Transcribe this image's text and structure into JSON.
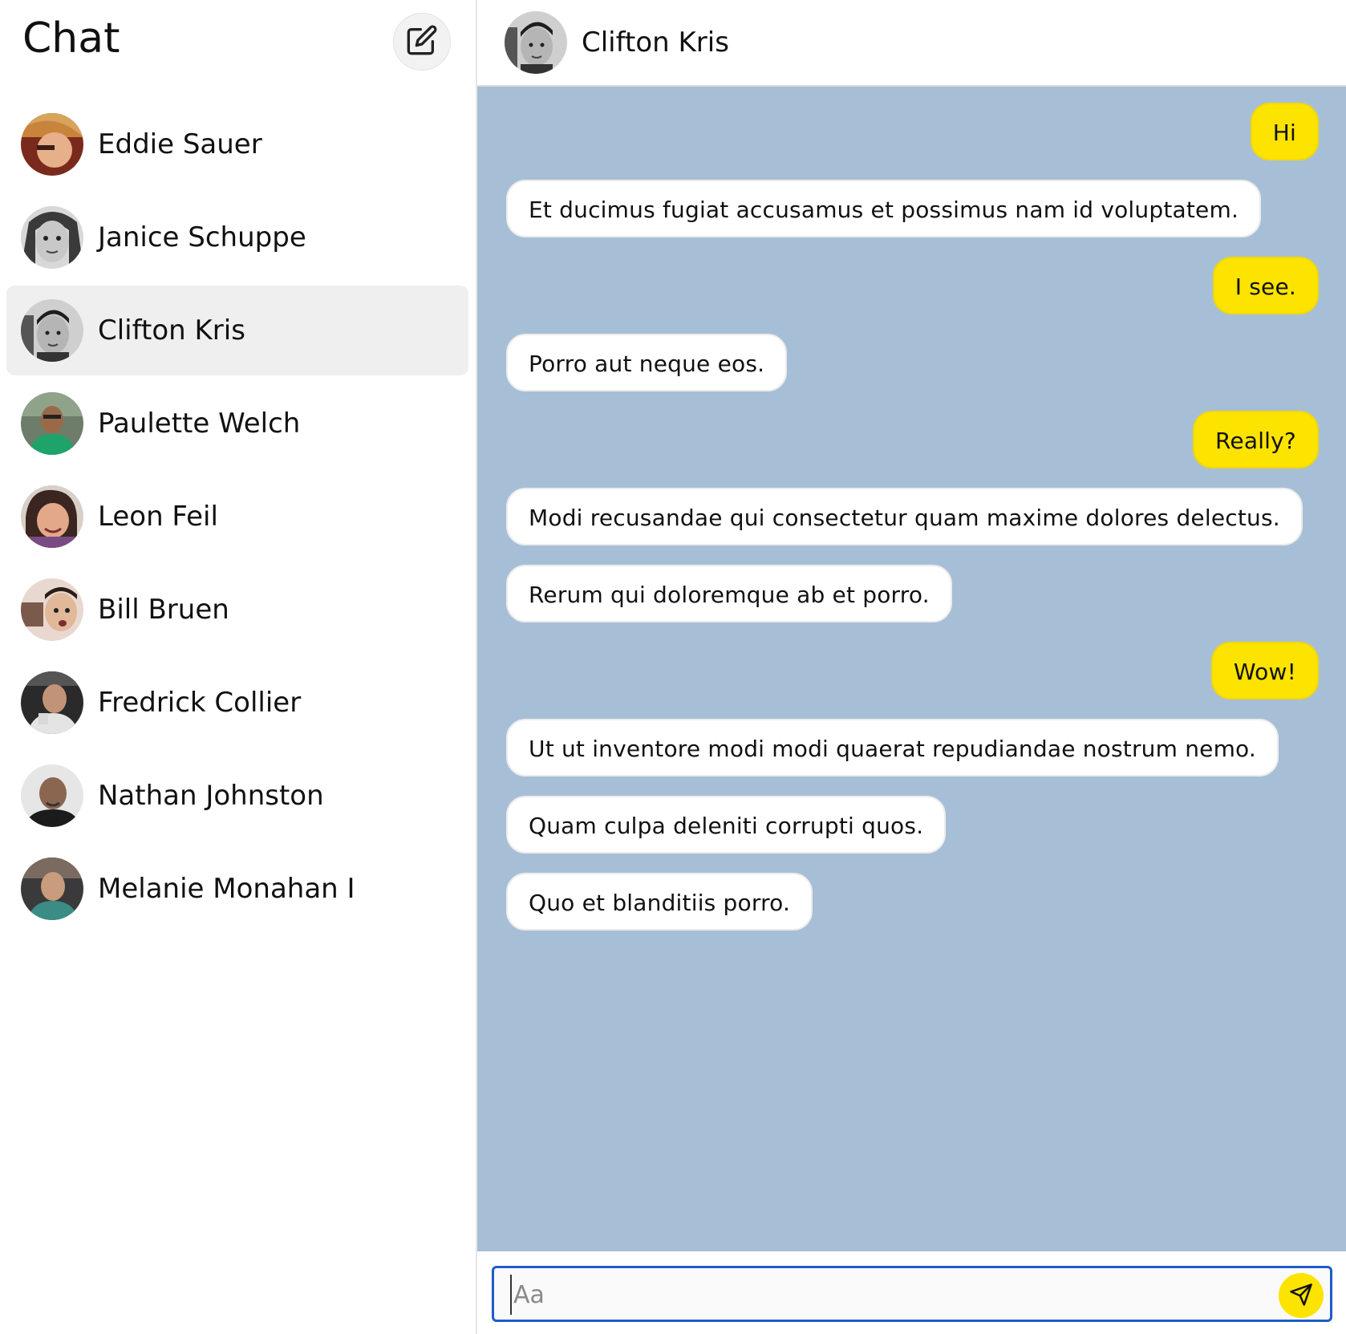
{
  "sidebar": {
    "title": "Chat",
    "compose_icon": "compose-edit-icon",
    "contacts": [
      {
        "name": "Eddie Sauer",
        "active": false
      },
      {
        "name": "Janice Schuppe",
        "active": false
      },
      {
        "name": "Clifton Kris",
        "active": true
      },
      {
        "name": "Paulette Welch",
        "active": false
      },
      {
        "name": "Leon Feil",
        "active": false
      },
      {
        "name": "Bill Bruen",
        "active": false
      },
      {
        "name": "Fredrick Collier",
        "active": false
      },
      {
        "name": "Nathan Johnston",
        "active": false
      },
      {
        "name": "Melanie Monahan I",
        "active": false
      }
    ]
  },
  "conversation": {
    "title": "Clifton Kris",
    "messages": [
      {
        "direction": "sent",
        "text": "Hi"
      },
      {
        "direction": "received",
        "text": "Et ducimus fugiat accusamus et possimus nam id voluptatem."
      },
      {
        "direction": "sent",
        "text": "I see."
      },
      {
        "direction": "received",
        "text": "Porro aut neque eos."
      },
      {
        "direction": "sent",
        "text": "Really?"
      },
      {
        "direction": "received",
        "text": "Modi recusandae qui consectetur quam maxime dolores delectus."
      },
      {
        "direction": "received",
        "text": "Rerum qui doloremque ab et porro."
      },
      {
        "direction": "sent",
        "text": "Wow!"
      },
      {
        "direction": "received",
        "text": "Ut ut inventore modi modi quaerat repudiandae nostrum nemo."
      },
      {
        "direction": "received",
        "text": "Quam culpa deleniti corrupti quos."
      },
      {
        "direction": "received",
        "text": "Quo et blanditiis porro."
      }
    ]
  },
  "composer": {
    "placeholder": "Aa",
    "value": "",
    "send_icon": "send-icon"
  },
  "colors": {
    "chat_background": "#a7bfd6",
    "sent_bubble": "#fce300",
    "received_bubble": "#ffffff",
    "input_focus_border": "#1e5cc8",
    "active_contact": "#efefef"
  }
}
